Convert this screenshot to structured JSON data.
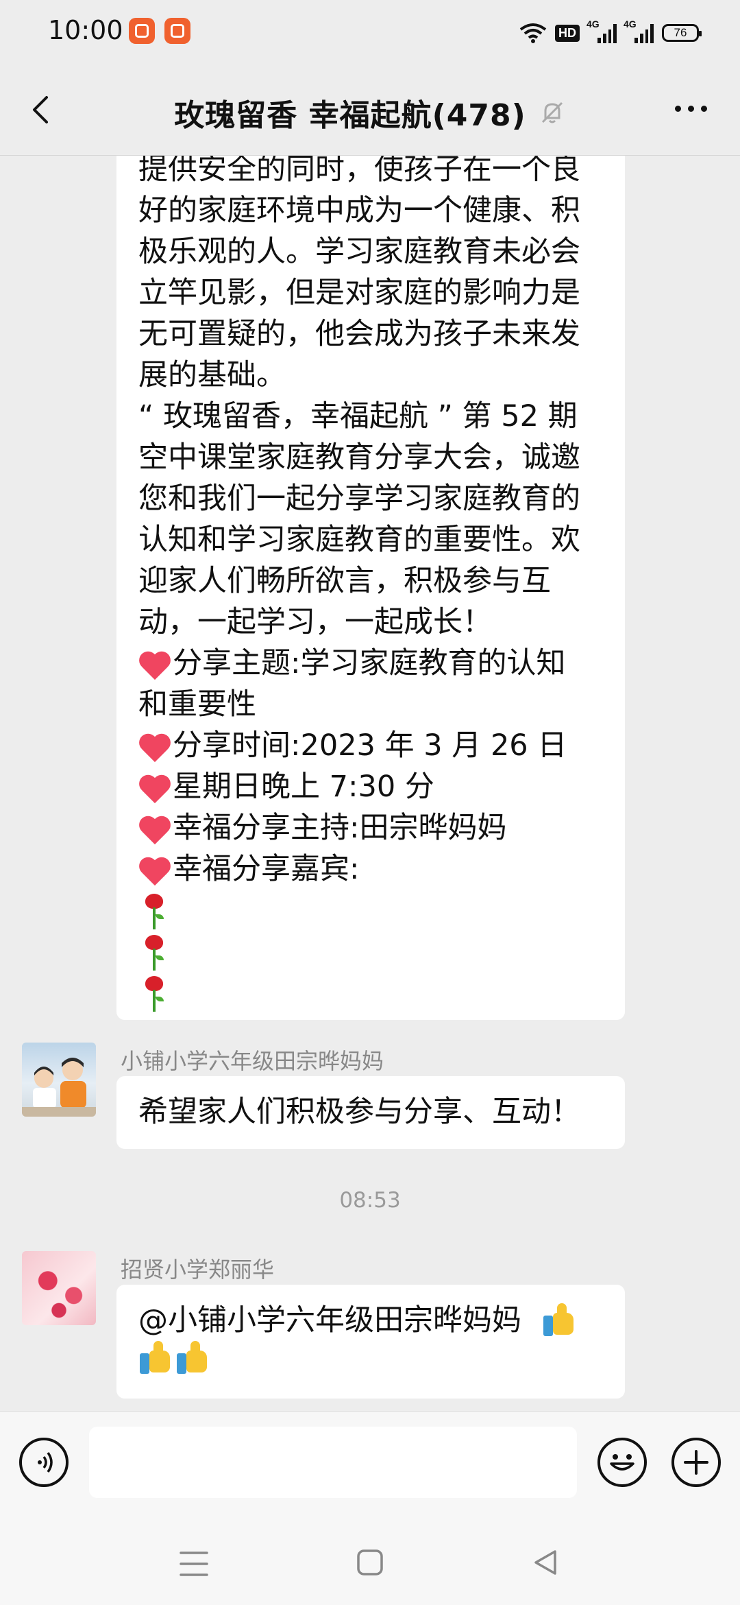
{
  "status_bar": {
    "time": "10:00",
    "hd_label": "HD",
    "signal_1": "4G",
    "signal_2": "4G",
    "battery": "76"
  },
  "header": {
    "title": "玫瑰留香  幸福起航(478)",
    "mute_icon": "bell-off-icon"
  },
  "messages": {
    "announcement": {
      "lines": [
        "提供安全的同时，使孩子在一个良",
        "好的家庭环境中成为一个健康、积",
        "极乐观的人。学习家庭教育未必会",
        "立竿见影，但是对家庭的影响力是",
        "无可置疑的，他会成为孩子未来发",
        "展的基础。",
        "“ 玫瑰留香，幸福起航 ” 第 52 期",
        "空中课堂家庭教育分享大会，诚邀",
        "您和我们一起分享学习家庭教育的",
        "认知和学习家庭教育的重要性。欢",
        "迎家人们畅所欲言，积极参与互",
        "动，一起学习，一起成长！"
      ],
      "topic_1": "分享主题:学习家庭教育的认知",
      "topic_2": "和重要性",
      "time_line": "分享时间:2023 年 3 月 26 日",
      "day_line": "星期日晚上 7:30 分",
      "host_line": "幸福分享主持:田宗晔妈妈",
      "guest_line": "幸福分享嘉宾:"
    },
    "msg1": {
      "sender": "小铺小学六年级田宗晔妈妈",
      "text": "希望家人们积极参与分享、互动！"
    },
    "timestamp": "08:53",
    "msg2": {
      "sender": "招贤小学郑丽华",
      "text": "@小铺小学六年级田宗晔妈妈"
    }
  },
  "colors": {
    "background": "#ededed",
    "bubble": "#ffffff",
    "heart": "#f04560"
  }
}
